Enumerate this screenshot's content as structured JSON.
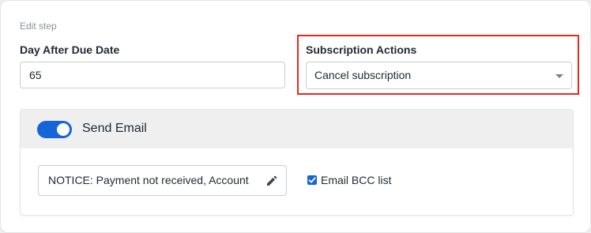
{
  "form": {
    "section_label": "Edit step",
    "day_after_due_date": {
      "label": "Day After Due Date",
      "value": "65"
    },
    "subscription_actions": {
      "label": "Subscription Actions",
      "selected": "Cancel subscription",
      "highlight_color": "#e8281e"
    }
  },
  "email_panel": {
    "toggle_on": true,
    "title": "Send Email",
    "subject": "NOTICE: Payment not received, Account",
    "subject_icon": "pencil-icon",
    "bcc_checked": true,
    "bcc_label": "Email BCC list"
  },
  "colors": {
    "accent": "#1565d8"
  }
}
